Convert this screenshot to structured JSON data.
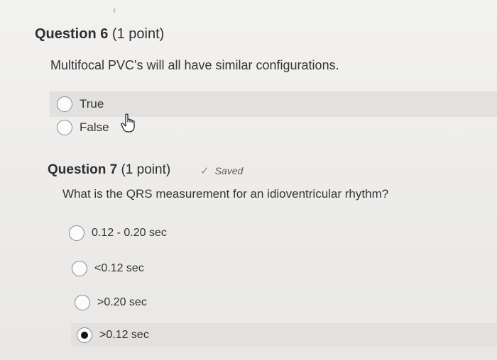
{
  "question6": {
    "number": "Question 6",
    "points": "(1 point)",
    "prompt": "Multifocal PVC's will all have similar configurations.",
    "options": [
      {
        "label": "True",
        "selected": false
      },
      {
        "label": "False",
        "selected": false
      }
    ]
  },
  "question7": {
    "number": "Question 7",
    "points": "(1 point)",
    "saved": "Saved",
    "prompt": "What is the QRS measurement for an idioventricular rhythm?",
    "options": [
      {
        "label": "0.12 - 0.20 sec",
        "selected": false
      },
      {
        "label": "<0.12 sec",
        "selected": false
      },
      {
        "label": ">0.20 sec",
        "selected": false
      },
      {
        "label": ">0.12 sec",
        "selected": true
      }
    ]
  },
  "icons": {
    "cursor": "hand-pointer-icon",
    "saved": "check-icon"
  }
}
